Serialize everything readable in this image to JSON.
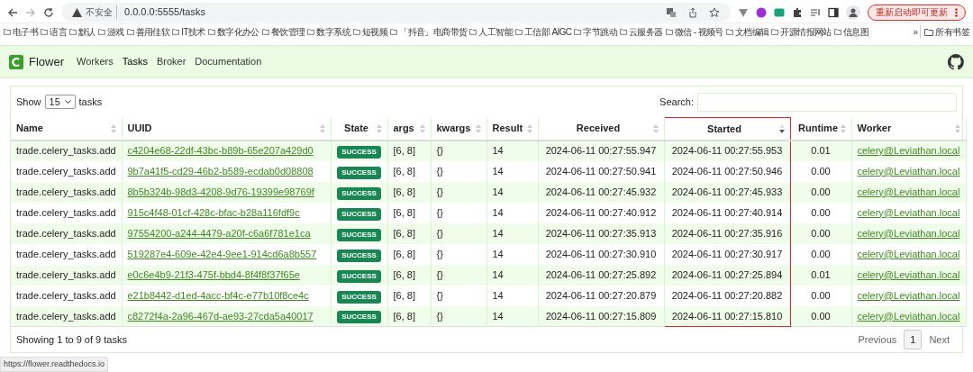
{
  "browser": {
    "address": {
      "warning": "不安全",
      "url": "0.0.0.0:5555/tasks"
    },
    "update_button": "重新启动即可更新",
    "bookmarks": [
      "电子书",
      "语言",
      "默认",
      "游戏",
      "善用佳软",
      "IT技术",
      "数字化办公",
      "餐饮管理",
      "数字系统",
      "短视频",
      "「抖音」电商带货",
      "人工智能",
      "工信部 AIGC",
      "字节跳动",
      "云服务器",
      "微信 - 视频号",
      "文档编辑",
      "开源情报网站",
      "信息图"
    ],
    "more_bookmarks": "»",
    "all_bookmarks": "所有书签"
  },
  "navbar": {
    "brand": "Flower",
    "links": [
      {
        "label": "Workers",
        "selected": false
      },
      {
        "label": "Tasks",
        "selected": true
      },
      {
        "label": "Broker",
        "selected": false
      },
      {
        "label": "Documentation",
        "selected": false
      }
    ]
  },
  "table": {
    "show_label": "Show",
    "page_size": "15",
    "show_suffix": "tasks",
    "search_label": "Search:",
    "columns": [
      {
        "label": "Name",
        "sorted": false,
        "highlighted": false
      },
      {
        "label": "UUID",
        "sorted": false,
        "highlighted": false
      },
      {
        "label": "State",
        "sorted": false,
        "highlighted": false
      },
      {
        "label": "args",
        "sorted": false,
        "highlighted": false
      },
      {
        "label": "kwargs",
        "sorted": false,
        "highlighted": false
      },
      {
        "label": "Result",
        "sorted": false,
        "highlighted": false
      },
      {
        "label": "Received",
        "sorted": false,
        "highlighted": false
      },
      {
        "label": "Started",
        "sorted": true,
        "highlighted": true
      },
      {
        "label": "Runtime",
        "sorted": false,
        "highlighted": false
      },
      {
        "label": "Worker",
        "sorted": false,
        "highlighted": false
      }
    ],
    "rows": [
      {
        "name": "trade.celery_tasks.add",
        "uuid": "c4204e68-22df-43bc-b89b-65e207a429d0",
        "state": "SUCCESS",
        "args": "[6, 8]",
        "kwargs": "{}",
        "result": "14",
        "received": "2024-06-11 00:27:55.947",
        "started": "2024-06-11 00:27:55.953",
        "runtime": "0.01",
        "worker": "celery@Leviathan.local"
      },
      {
        "name": "trade.celery_tasks.add",
        "uuid": "9b7a41f5-cd29-46b2-b589-ecdab0d08808",
        "state": "SUCCESS",
        "args": "[6, 8]",
        "kwargs": "{}",
        "result": "14",
        "received": "2024-06-11 00:27:50.941",
        "started": "2024-06-11 00:27:50.946",
        "runtime": "0.00",
        "worker": "celery@Leviathan.local"
      },
      {
        "name": "trade.celery_tasks.add",
        "uuid": "8b5b324b-98d3-4208-9d76-19399e98769f",
        "state": "SUCCESS",
        "args": "[6, 8]",
        "kwargs": "{}",
        "result": "14",
        "received": "2024-06-11 00:27:45.932",
        "started": "2024-06-11 00:27:45.933",
        "runtime": "0.00",
        "worker": "celery@Leviathan.local"
      },
      {
        "name": "trade.celery_tasks.add",
        "uuid": "915c4f48-01cf-428c-bfac-b28a116fdf9c",
        "state": "SUCCESS",
        "args": "[6, 8]",
        "kwargs": "{}",
        "result": "14",
        "received": "2024-06-11 00:27:40.912",
        "started": "2024-06-11 00:27:40.914",
        "runtime": "0.00",
        "worker": "celery@Leviathan.local"
      },
      {
        "name": "trade.celery_tasks.add",
        "uuid": "97554200-a244-4479-a20f-c6a6f781e1ca",
        "state": "SUCCESS",
        "args": "[6, 8]",
        "kwargs": "{}",
        "result": "14",
        "received": "2024-06-11 00:27:35.913",
        "started": "2024-06-11 00:27:35.916",
        "runtime": "0.00",
        "worker": "celery@Leviathan.local"
      },
      {
        "name": "trade.celery_tasks.add",
        "uuid": "519287e4-609e-42e4-9ee1-914cd6a8b557",
        "state": "SUCCESS",
        "args": "[6, 8]",
        "kwargs": "{}",
        "result": "14",
        "received": "2024-06-11 00:27:30.910",
        "started": "2024-06-11 00:27:30.917",
        "runtime": "0.00",
        "worker": "celery@Leviathan.local"
      },
      {
        "name": "trade.celery_tasks.add",
        "uuid": "e0c6e4b9-21f3-475f-bbd4-8f4f8f37f65e",
        "state": "SUCCESS",
        "args": "[6, 8]",
        "kwargs": "{}",
        "result": "14",
        "received": "2024-06-11 00:27:25.892",
        "started": "2024-06-11 00:27:25.894",
        "runtime": "0.01",
        "worker": "celery@Leviathan.local"
      },
      {
        "name": "trade.celery_tasks.add",
        "uuid": "e21b8442-d1ed-4acc-bf4c-e77b10f8ce4c",
        "state": "SUCCESS",
        "args": "[6, 8]",
        "kwargs": "{}",
        "result": "14",
        "received": "2024-06-11 00:27:20.879",
        "started": "2024-06-11 00:27:20.882",
        "runtime": "0.00",
        "worker": "celery@Leviathan.local"
      },
      {
        "name": "trade.celery_tasks.add",
        "uuid": "c8272f4a-2a96-467d-ae93-27cda5a40017",
        "state": "SUCCESS",
        "args": "[6, 8]",
        "kwargs": "{}",
        "result": "14",
        "received": "2024-06-11 00:27:15.809",
        "started": "2024-06-11 00:27:15.810",
        "runtime": "0.00",
        "worker": "celery@Leviathan.local"
      }
    ],
    "info": "Showing 1 to 9 of 9 tasks",
    "pagination": {
      "previous": "Previous",
      "pages": [
        {
          "label": "1",
          "selected": true
        }
      ],
      "next": "Next"
    }
  },
  "status_bar": "https://flower.readthedocs.io"
}
